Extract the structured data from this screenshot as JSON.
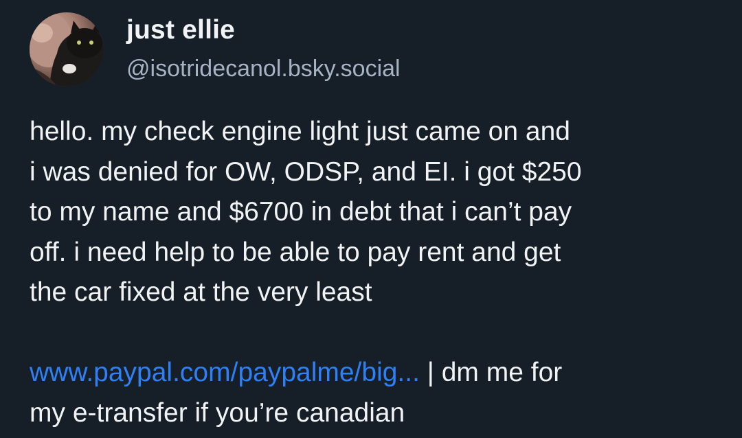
{
  "author": {
    "display_name": "just ellie",
    "handle": "@isotridecanol.bsky.social",
    "avatar_icon": "avatar-photo-cat"
  },
  "post": {
    "lines": [
      "hello. my check engine light just came on and",
      "i was denied for OW, ODSP, and EI. i got $250",
      "to my name and $6700 in debt that i can’t pay",
      "off. i need help to be able to pay rent and get",
      "the car fixed at the very least"
    ],
    "link_text": "www.paypal.com/paypalme/big...",
    "after_link_line1": " | dm me for",
    "after_link_line2": "my e-transfer if you’re canadian"
  },
  "colors": {
    "background": "#161e27",
    "text": "#f1f3f5",
    "handle": "#a6b3c5",
    "link": "#2f80f5"
  }
}
